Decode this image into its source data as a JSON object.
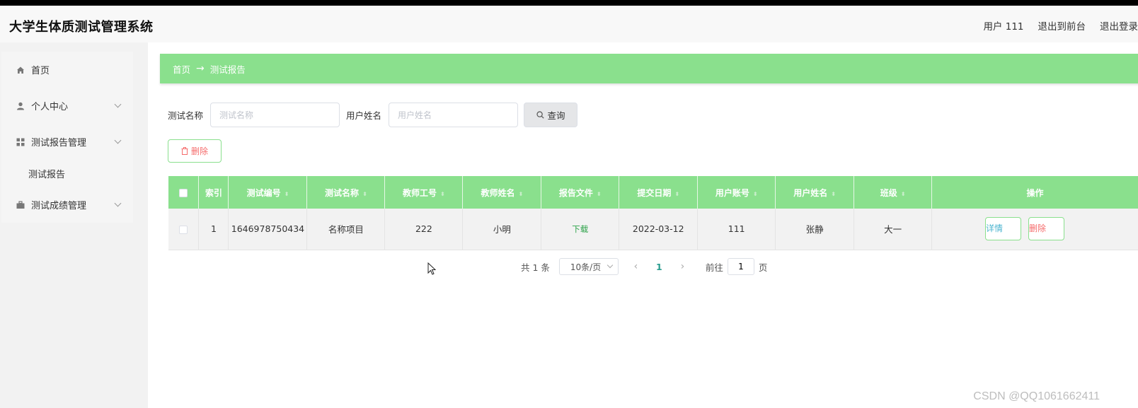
{
  "header": {
    "title": "大学生体质测试管理系统",
    "user": "用户 111",
    "back_to_front": "退出到前台",
    "logout": "退出登录"
  },
  "sidebar": {
    "items": [
      {
        "label": "首页",
        "icon": "home-icon"
      },
      {
        "label": "个人中心",
        "icon": "user-icon"
      },
      {
        "label": "测试报告管理",
        "icon": "grid-icon"
      },
      {
        "label": "测试报告",
        "icon": ""
      },
      {
        "label": "测试成绩管理",
        "icon": "briefcase-icon"
      }
    ]
  },
  "breadcrumb": {
    "home": "首页",
    "separator": "→",
    "current": "测试报告"
  },
  "search": {
    "test_name_label": "测试名称",
    "test_name_placeholder": "测试名称",
    "user_name_label": "用户姓名",
    "user_name_placeholder": "用户姓名",
    "query_label": "查询"
  },
  "actions": {
    "delete_label": "删除"
  },
  "table": {
    "headers": [
      "索引",
      "测试编号",
      "测试名称",
      "教师工号",
      "教师姓名",
      "报告文件",
      "提交日期",
      "用户账号",
      "用户姓名",
      "班级",
      "操作"
    ],
    "rows": [
      {
        "index": "1",
        "test_no": "1646978750434",
        "test_name": "名称项目",
        "teacher_no": "222",
        "teacher_name": "小明",
        "report_file": "下载",
        "submit_date": "2022-03-12",
        "user_account": "111",
        "user_name": "张静",
        "class": "大一",
        "detail": "详情",
        "delete": "删除"
      }
    ]
  },
  "pagination": {
    "total": "共 1 条",
    "page_size": "10条/页",
    "current_page": "1",
    "goto_label": "前往",
    "goto_value": "1",
    "page_suffix": "页"
  },
  "watermark": "CSDN @QQ1061662411",
  "colors": {
    "accent_green": "#8ae08d",
    "danger": "#f56c6c",
    "info": "#4db5d0"
  }
}
